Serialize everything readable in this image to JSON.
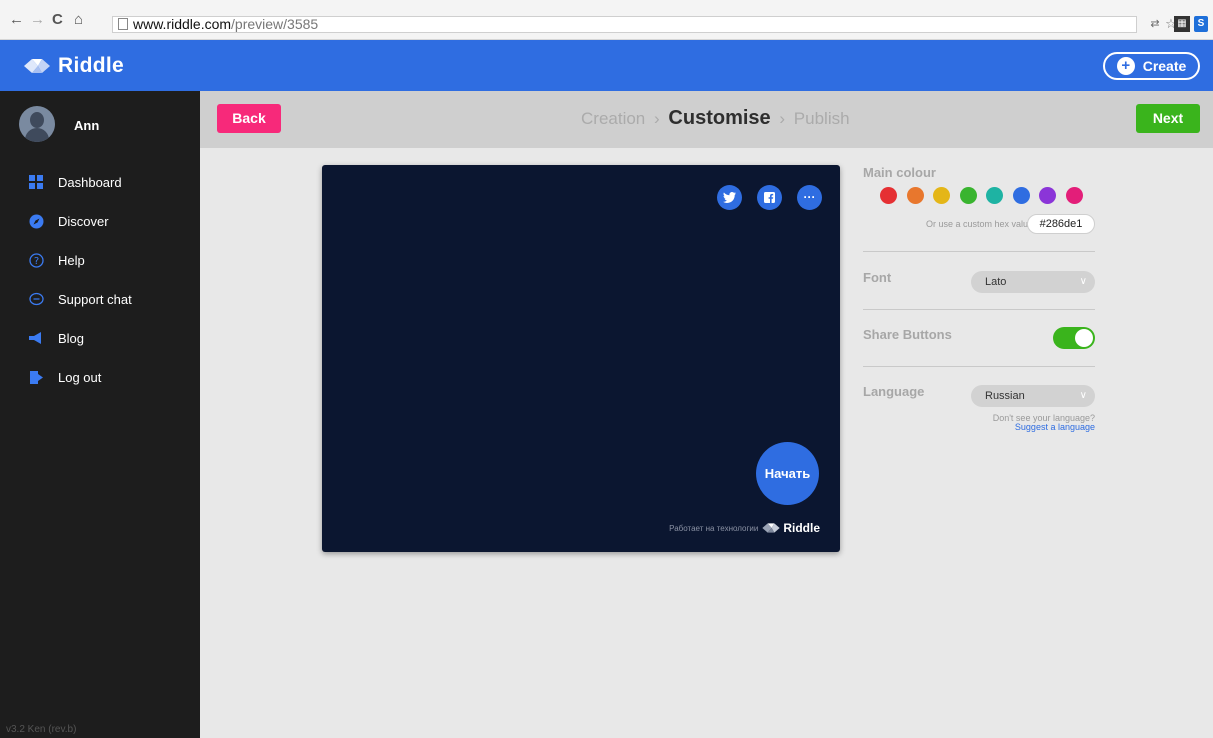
{
  "browser": {
    "url_host": "www.riddle.com",
    "url_path": "/preview/3585"
  },
  "header": {
    "logo_text": "Riddle",
    "create_label": "Create"
  },
  "sidebar": {
    "user_name": "Ann",
    "items": [
      {
        "label": "Dashboard",
        "icon": "grid-icon"
      },
      {
        "label": "Discover",
        "icon": "compass-icon"
      },
      {
        "label": "Help",
        "icon": "help-icon"
      },
      {
        "label": "Support chat",
        "icon": "chat-icon"
      },
      {
        "label": "Blog",
        "icon": "megaphone-icon"
      },
      {
        "label": "Log out",
        "icon": "logout-icon"
      }
    ],
    "version": "v3.2 Ken (rev.b)"
  },
  "steps": {
    "back_label": "Back",
    "next_label": "Next",
    "step1": "Creation",
    "step2": "Customise",
    "step3": "Publish",
    "separator": "›"
  },
  "preview": {
    "start_label": "Начать",
    "powered_by": "Работает на технологии",
    "powered_brand": "Riddle",
    "share_icons": [
      "twitter-icon",
      "facebook-icon",
      "more-icon"
    ],
    "more_glyph": "···",
    "background": "#0b1630"
  },
  "settings": {
    "main_colour_label": "Main colour",
    "swatches": [
      "#e53033",
      "#e8772d",
      "#e4b618",
      "#39b42f",
      "#1eb3a3",
      "#2f6de1",
      "#8b35d8",
      "#e31e79"
    ],
    "hex_hint": "Or use a custom hex value",
    "hex_value": "#286de1",
    "font_label": "Font",
    "font_value": "Lato",
    "share_buttons_label": "Share Buttons",
    "share_buttons_on": true,
    "language_label": "Language",
    "language_value": "Russian",
    "language_hint": "Don't see your language?",
    "language_link": "Suggest a language"
  }
}
